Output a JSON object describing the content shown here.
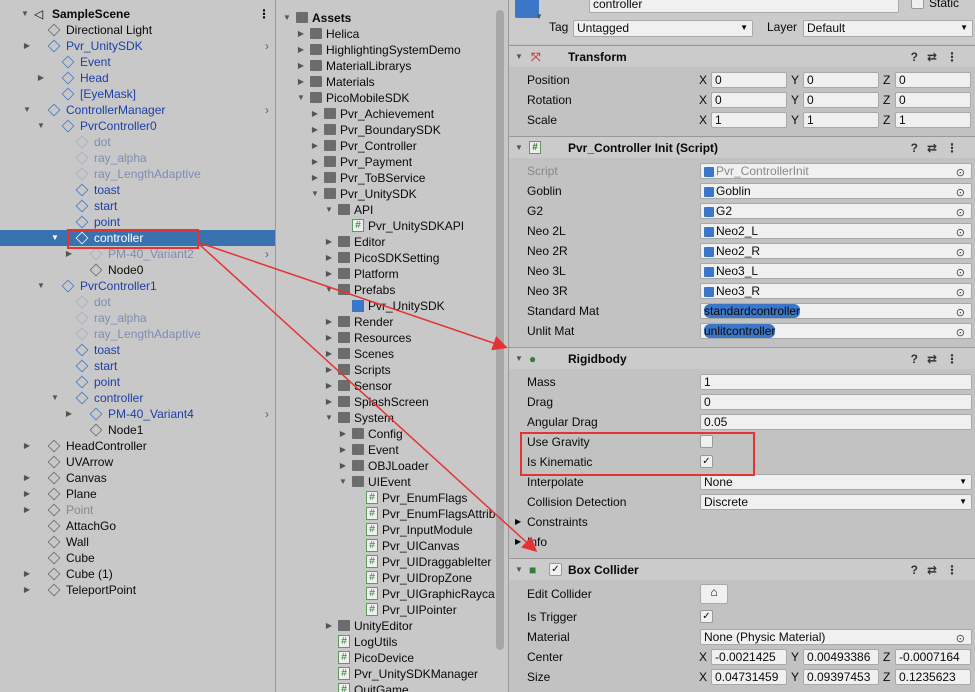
{
  "hierarchy": {
    "scene": "SampleScene",
    "items": [
      {
        "label": "Directional Light",
        "color": "normal"
      },
      {
        "label": "Pvr_UnitySDK",
        "color": "blue"
      },
      {
        "label": "Event",
        "color": "blue"
      },
      {
        "label": "Head",
        "color": "blue"
      },
      {
        "label": "[EyeMask]",
        "color": "blue"
      },
      {
        "label": "ControllerManager",
        "color": "blue"
      },
      {
        "label": "PvrController0",
        "color": "blue"
      },
      {
        "label": "dot",
        "color": "faded"
      },
      {
        "label": "ray_alpha",
        "color": "faded"
      },
      {
        "label": "ray_LengthAdaptive",
        "color": "faded"
      },
      {
        "label": "toast",
        "color": "blue"
      },
      {
        "label": "start",
        "color": "blue"
      },
      {
        "label": "point",
        "color": "blue"
      },
      {
        "label": "controller",
        "color": "selected"
      },
      {
        "label": "PM-40_Variant2",
        "color": "faded"
      },
      {
        "label": "Node0",
        "color": "normal"
      },
      {
        "label": "PvrController1",
        "color": "blue"
      },
      {
        "label": "dot",
        "color": "faded"
      },
      {
        "label": "ray_alpha",
        "color": "faded"
      },
      {
        "label": "ray_LengthAdaptive",
        "color": "faded"
      },
      {
        "label": "toast",
        "color": "blue"
      },
      {
        "label": "start",
        "color": "blue"
      },
      {
        "label": "point",
        "color": "blue"
      },
      {
        "label": "controller",
        "color": "blue"
      },
      {
        "label": "PM-40_Variant4",
        "color": "blue"
      },
      {
        "label": "Node1",
        "color": "normal"
      },
      {
        "label": "HeadController",
        "color": "normal"
      },
      {
        "label": "UVArrow",
        "color": "normal"
      },
      {
        "label": "Canvas",
        "color": "normal"
      },
      {
        "label": "Plane",
        "color": "normal"
      },
      {
        "label": "Point",
        "color": "grey"
      },
      {
        "label": "AttachGo",
        "color": "normal"
      },
      {
        "label": "Wall",
        "color": "normal"
      },
      {
        "label": "Cube",
        "color": "normal"
      },
      {
        "label": "Cube (1)",
        "color": "normal"
      },
      {
        "label": "TeleportPoint",
        "color": "normal"
      }
    ]
  },
  "project": {
    "items": [
      {
        "label": "Assets",
        "kind": "folder"
      },
      {
        "label": "Helica",
        "kind": "folder"
      },
      {
        "label": "HighlightingSystemDemo",
        "kind": "folder"
      },
      {
        "label": "MaterialLibrarys",
        "kind": "folder"
      },
      {
        "label": "Materials",
        "kind": "folder"
      },
      {
        "label": "PicoMobileSDK",
        "kind": "folder"
      },
      {
        "label": "Pvr_Achievement",
        "kind": "folder"
      },
      {
        "label": "Pvr_BoundarySDK",
        "kind": "folder"
      },
      {
        "label": "Pvr_Controller",
        "kind": "folder"
      },
      {
        "label": "Pvr_Payment",
        "kind": "folder"
      },
      {
        "label": "Pvr_ToBService",
        "kind": "folder"
      },
      {
        "label": "Pvr_UnitySDK",
        "kind": "folder"
      },
      {
        "label": "API",
        "kind": "folder"
      },
      {
        "label": "Pvr_UnitySDKAPI",
        "kind": "script"
      },
      {
        "label": "Editor",
        "kind": "folder"
      },
      {
        "label": "PicoSDKSetting",
        "kind": "folder"
      },
      {
        "label": "Platform",
        "kind": "folder"
      },
      {
        "label": "Prefabs",
        "kind": "folder"
      },
      {
        "label": "Pvr_UnitySDK",
        "kind": "prefab"
      },
      {
        "label": "Render",
        "kind": "folder"
      },
      {
        "label": "Resources",
        "kind": "folder"
      },
      {
        "label": "Scenes",
        "kind": "folder"
      },
      {
        "label": "Scripts",
        "kind": "folder"
      },
      {
        "label": "Sensor",
        "kind": "folder"
      },
      {
        "label": "SplashScreen",
        "kind": "folder"
      },
      {
        "label": "System",
        "kind": "folder"
      },
      {
        "label": "Config",
        "kind": "folder"
      },
      {
        "label": "Event",
        "kind": "folder"
      },
      {
        "label": "OBJLoader",
        "kind": "folder"
      },
      {
        "label": "UIEvent",
        "kind": "folder"
      },
      {
        "label": "Pvr_EnumFlags",
        "kind": "script"
      },
      {
        "label": "Pvr_EnumFlagsAttrib",
        "kind": "script"
      },
      {
        "label": "Pvr_InputModule",
        "kind": "script"
      },
      {
        "label": "Pvr_UICanvas",
        "kind": "script"
      },
      {
        "label": "Pvr_UIDraggableIter",
        "kind": "script"
      },
      {
        "label": "Pvr_UIDropZone",
        "kind": "script"
      },
      {
        "label": "Pvr_UIGraphicRayca",
        "kind": "script"
      },
      {
        "label": "Pvr_UIPointer",
        "kind": "script"
      },
      {
        "label": "UnityEditor",
        "kind": "folder"
      },
      {
        "label": "LogUtils",
        "kind": "script"
      },
      {
        "label": "PicoDevice",
        "kind": "script"
      },
      {
        "label": "Pvr_UnitySDKManager",
        "kind": "script"
      },
      {
        "label": "QuitGame",
        "kind": "script"
      }
    ]
  },
  "inspector": {
    "name": "controller",
    "static_label": "Static",
    "tag_label": "Tag",
    "tag_value": "Untagged",
    "layer_label": "Layer",
    "layer_value": "Default",
    "transform": {
      "title": "Transform",
      "position": {
        "label": "Position",
        "x": "0",
        "y": "0",
        "z": "0"
      },
      "rotation": {
        "label": "Rotation",
        "x": "0",
        "y": "0",
        "z": "0"
      },
      "scale": {
        "label": "Scale",
        "x": "1",
        "y": "1",
        "z": "1"
      }
    },
    "script": {
      "title": "Pvr_Controller Init (Script)",
      "rows": [
        {
          "label": "Script",
          "value": "Pvr_ControllerInit"
        },
        {
          "label": "Goblin",
          "value": "Goblin"
        },
        {
          "label": "G2",
          "value": "G2"
        },
        {
          "label": "Neo 2L",
          "value": "Neo2_L"
        },
        {
          "label": "Neo 2R",
          "value": "Neo2_R"
        },
        {
          "label": "Neo 3L",
          "value": "Neo3_L"
        },
        {
          "label": "Neo 3R",
          "value": "Neo3_R"
        },
        {
          "label": "Standard Mat",
          "value": "standardcontroller"
        },
        {
          "label": "Unlit Mat",
          "value": "unlitcontroller"
        }
      ]
    },
    "rigidbody": {
      "title": "Rigidbody",
      "mass": {
        "label": "Mass",
        "value": "1"
      },
      "drag": {
        "label": "Drag",
        "value": "0"
      },
      "angular_drag": {
        "label": "Angular Drag",
        "value": "0.05"
      },
      "use_gravity": {
        "label": "Use Gravity",
        "checked": false
      },
      "is_kinematic": {
        "label": "Is Kinematic",
        "checked": true
      },
      "interpolate": {
        "label": "Interpolate",
        "value": "None"
      },
      "collision": {
        "label": "Collision Detection",
        "value": "Discrete"
      },
      "constraints": "Constraints",
      "info": "Info"
    },
    "box_collider": {
      "title": "Box Collider",
      "edit_collider": "Edit Collider",
      "is_trigger": {
        "label": "Is Trigger",
        "checked": true
      },
      "material": {
        "label": "Material",
        "value": "None (Physic Material)"
      },
      "center": {
        "label": "Center",
        "x": "-0.0021425",
        "y": "0.00493386",
        "z": "-0.0007164"
      },
      "size": {
        "label": "Size",
        "x": "0.04731459",
        "y": "0.09397453",
        "z": "0.1235623"
      }
    }
  },
  "colors": {
    "selection": "#3a72b0",
    "highlight": "#e53333",
    "prefab_blue": "#1c3fa8"
  }
}
